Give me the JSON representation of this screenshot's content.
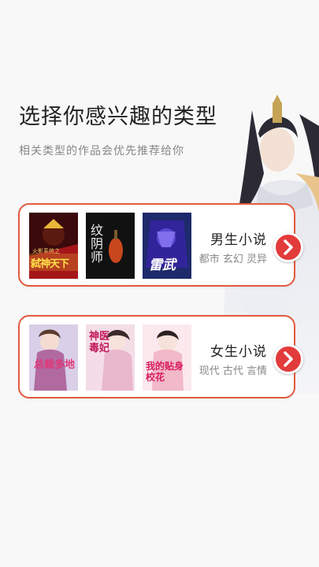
{
  "header": {
    "title": "选择你感兴趣的类型",
    "subtitle": "相关类型的作品会优先推荐给你"
  },
  "categories": [
    {
      "label": "男生小说",
      "tags": "都市 玄幻 灵异",
      "covers": [
        {
          "text": "弑神天下",
          "subtext": "火影系统之"
        },
        {
          "text": "纹阴师",
          "subtext": ""
        },
        {
          "text": "雷武",
          "subtext": ""
        }
      ]
    },
    {
      "label": "女生小说",
      "tags": "现代 古代 言情",
      "covers": [
        {
          "text": "总裁多地",
          "subtext": ""
        },
        {
          "text": "神医毒妃",
          "subtext": ""
        },
        {
          "text": "我的贴身校花",
          "subtext": ""
        }
      ]
    }
  ],
  "colors": {
    "accent": "#e25a3f",
    "arrow": "#e23b3b",
    "background": "#f8f8f8"
  },
  "icons": {
    "arrow": "chevron-right-icon"
  }
}
